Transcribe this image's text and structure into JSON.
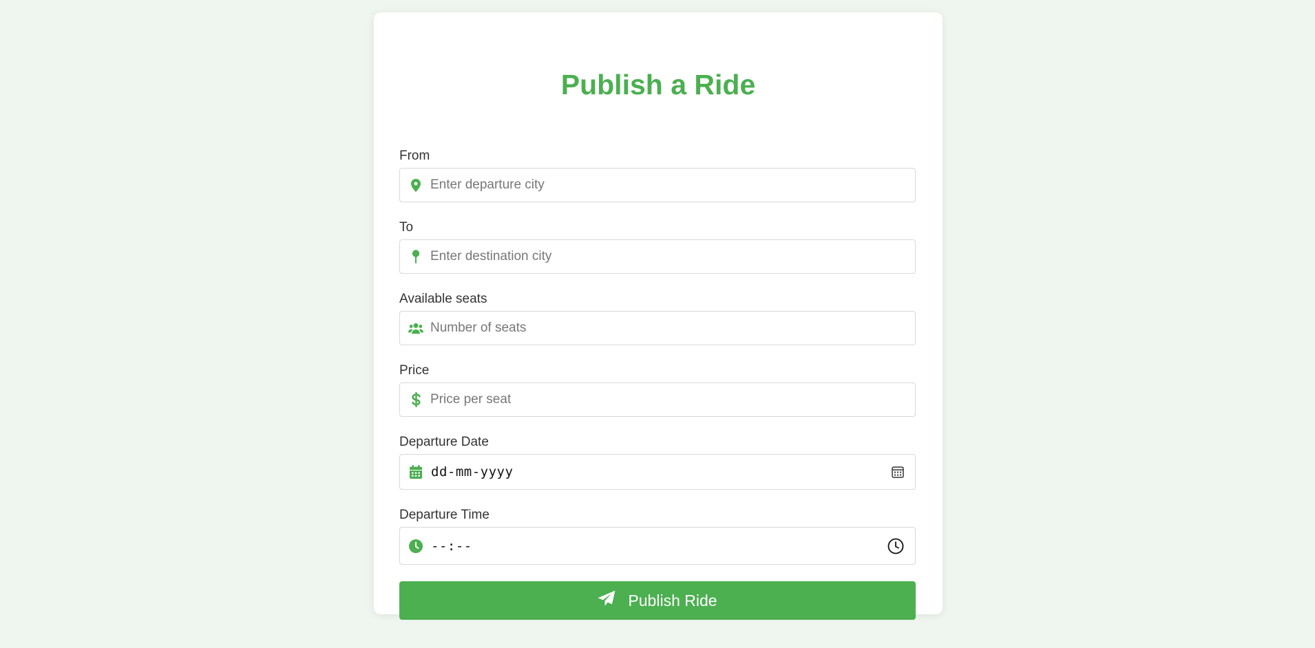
{
  "form": {
    "title": "Publish a Ride",
    "fields": [
      {
        "label": "From",
        "placeholder": "Enter departure city",
        "icon": "map-marker-icon"
      },
      {
        "label": "To",
        "placeholder": "Enter destination city",
        "icon": "map-pin-icon"
      },
      {
        "label": "Available seats",
        "placeholder": "Number of seats",
        "icon": "users-icon"
      },
      {
        "label": "Price",
        "placeholder": "Price per seat",
        "icon": "dollar-icon"
      },
      {
        "label": "Departure Date",
        "value": "dd-mm-yyyy",
        "icon": "calendar-icon",
        "trailing_icon": "calendar-picker-icon"
      },
      {
        "label": "Departure Time",
        "value": "--:--",
        "icon": "clock-icon",
        "trailing_icon": "clock-picker-icon"
      }
    ],
    "submit_label": "Publish Ride",
    "submit_icon": "paper-plane-icon"
  },
  "colors": {
    "accent": "#4caf50",
    "background": "#eff6ef",
    "card": "#ffffff",
    "border": "#d8d8d8"
  }
}
